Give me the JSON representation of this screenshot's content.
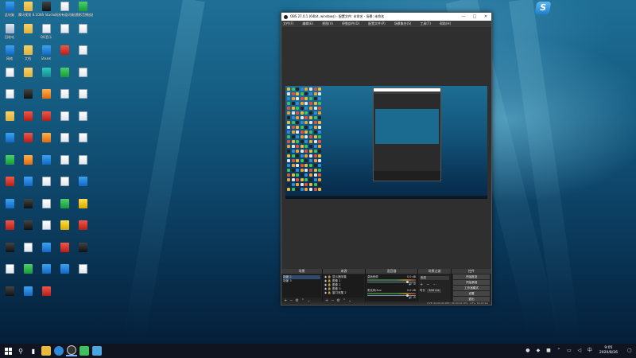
{
  "desktop_icons": [
    {
      "label": "此电脑",
      "glyph": "pc-icon",
      "color": "blue"
    },
    {
      "label": "腾讯视频 8.1",
      "glyph": "folder-icon",
      "color": "folder"
    },
    {
      "label": "OBS Studio",
      "glyph": "obs-icon",
      "color": "dark"
    },
    {
      "label": "网易有道词典",
      "glyph": "document-icon",
      "color": "doc"
    },
    {
      "label": "迅雷影音播放器",
      "glyph": "app-icon",
      "color": "green"
    },
    {
      "label": "回收站",
      "glyph": "recycle-bin-icon",
      "color": "bin"
    },
    {
      "label": "",
      "glyph": "folder-icon",
      "color": "folder"
    },
    {
      "label": "QQ音乐",
      "glyph": "document-icon",
      "color": "doc"
    },
    {
      "label": "",
      "glyph": "document-icon",
      "color": "doc"
    },
    {
      "label": "",
      "glyph": "document-icon",
      "color": "doc"
    },
    {
      "label": "网络",
      "glyph": "network-icon",
      "color": "blue"
    },
    {
      "label": "文档",
      "glyph": "folder-icon",
      "color": "folder"
    },
    {
      "label": "Steam",
      "glyph": "steam-icon",
      "color": "blue"
    },
    {
      "label": "",
      "glyph": "app-icon",
      "color": "red"
    },
    {
      "label": "",
      "glyph": "document-icon",
      "color": "doc"
    },
    {
      "label": "",
      "glyph": "document-icon",
      "color": "doc"
    },
    {
      "label": "",
      "glyph": "folder-icon",
      "color": "folder"
    },
    {
      "label": "",
      "glyph": "app-icon",
      "color": "teal"
    },
    {
      "label": "",
      "glyph": "app-icon",
      "color": "green"
    },
    {
      "label": "",
      "glyph": "document-icon",
      "color": "doc"
    },
    {
      "label": "",
      "glyph": "document-icon",
      "color": "doc"
    },
    {
      "label": "",
      "glyph": "app-icon",
      "color": "dark"
    },
    {
      "label": "",
      "glyph": "app-icon",
      "color": "orange"
    },
    {
      "label": "",
      "glyph": "document-icon",
      "color": "doc"
    },
    {
      "label": "",
      "glyph": "document-icon",
      "color": "doc"
    },
    {
      "label": "",
      "glyph": "folder-icon",
      "color": "folder"
    },
    {
      "label": "",
      "glyph": "app-icon",
      "color": "red"
    },
    {
      "label": "",
      "glyph": "app-icon",
      "color": "red"
    },
    {
      "label": "",
      "glyph": "document-icon",
      "color": "doc"
    },
    {
      "label": "",
      "glyph": "document-icon",
      "color": "doc"
    },
    {
      "label": "",
      "glyph": "app-icon",
      "color": "blue"
    },
    {
      "label": "",
      "glyph": "app-icon",
      "color": "red"
    },
    {
      "label": "",
      "glyph": "app-icon",
      "color": "orange"
    },
    {
      "label": "",
      "glyph": "document-icon",
      "color": "doc"
    },
    {
      "label": "",
      "glyph": "document-icon",
      "color": "doc"
    },
    {
      "label": "",
      "glyph": "app-icon",
      "color": "green"
    },
    {
      "label": "",
      "glyph": "app-icon",
      "color": "orange"
    },
    {
      "label": "",
      "glyph": "app-icon",
      "color": "blue"
    },
    {
      "label": "",
      "glyph": "document-icon",
      "color": "doc"
    },
    {
      "label": "",
      "glyph": "document-icon",
      "color": "doc"
    },
    {
      "label": "",
      "glyph": "app-icon",
      "color": "red"
    },
    {
      "label": "",
      "glyph": "app-icon",
      "color": "blue"
    },
    {
      "label": "",
      "glyph": "document-icon",
      "color": "doc"
    },
    {
      "label": "",
      "glyph": "document-icon",
      "color": "doc"
    },
    {
      "label": "",
      "glyph": "app-icon",
      "color": "blue"
    },
    {
      "label": "",
      "glyph": "app-icon",
      "color": "blue"
    },
    {
      "label": "",
      "glyph": "app-icon",
      "color": "dark"
    },
    {
      "label": "",
      "glyph": "document-icon",
      "color": "doc"
    },
    {
      "label": "",
      "glyph": "app-icon",
      "color": "green"
    },
    {
      "label": "",
      "glyph": "app-icon",
      "color": "yellow"
    },
    {
      "label": "",
      "glyph": "app-icon",
      "color": "red"
    },
    {
      "label": "",
      "glyph": "app-icon",
      "color": "dark"
    },
    {
      "label": "",
      "glyph": "document-icon",
      "color": "doc"
    },
    {
      "label": "",
      "glyph": "app-icon",
      "color": "yellow"
    },
    {
      "label": "",
      "glyph": "app-icon",
      "color": "red"
    },
    {
      "label": "",
      "glyph": "app-icon",
      "color": "dark"
    },
    {
      "label": "",
      "glyph": "document-icon",
      "color": "doc"
    },
    {
      "label": "",
      "glyph": "app-icon",
      "color": "blue"
    },
    {
      "label": "",
      "glyph": "app-icon",
      "color": "red"
    },
    {
      "label": "",
      "glyph": "app-icon",
      "color": "dark"
    },
    {
      "label": "",
      "glyph": "document-icon",
      "color": "doc"
    },
    {
      "label": "",
      "glyph": "app-icon",
      "color": "green"
    },
    {
      "label": "",
      "glyph": "app-icon",
      "color": "blue"
    },
    {
      "label": "",
      "glyph": "app-icon",
      "color": "blue"
    },
    {
      "label": "",
      "glyph": "document-icon",
      "color": "doc"
    },
    {
      "label": "",
      "glyph": "app-icon",
      "color": "dark"
    },
    {
      "label": "",
      "glyph": "app-icon",
      "color": "blue"
    },
    {
      "label": "",
      "glyph": "app-icon",
      "color": "red"
    }
  ],
  "obs": {
    "title": "OBS 27.0.1 (64bit, windows) - 配置文件: 未命名 - 场景: 未命名",
    "menu": [
      "文件(F)",
      "编辑(E)",
      "视图(V)",
      "停靠部件(D)",
      "配置文件(P)",
      "场景集合(S)",
      "工具(T)",
      "帮助(H)"
    ],
    "docks": {
      "scenes_title": "场景",
      "scenes": [
        "场景 2",
        "场景 3"
      ],
      "sources_title": "来源",
      "sources": [
        "显示器采集",
        "图像 1",
        "图像 2",
        "图像 3",
        "窗口采集 2"
      ],
      "mixer_title": "混音器",
      "mixer": [
        {
          "name": "桌面音频",
          "level": "0.0 dB",
          "volume": 0.8
        },
        {
          "name": "麦克风/Aux",
          "level": "0.0 dB",
          "volume": 0.8
        }
      ],
      "transitions_title": "场景过渡",
      "transition_name": "渐变",
      "duration_label": "时长",
      "duration_value": "300 ms",
      "controls_title": "控件",
      "controls": [
        "开始推流",
        "开始录制",
        "工作室模式",
        "设置",
        "退出"
      ]
    },
    "status": "LIVE: 00:00:00    REC: 00:00:00    CPU: 1.8%, 60.00 fps"
  },
  "taskbar": {
    "time": "9:05",
    "date": "2020/8/26"
  },
  "colors": {
    "accent": "#7ab6ff",
    "obs_bg": "#2b2b2b"
  }
}
